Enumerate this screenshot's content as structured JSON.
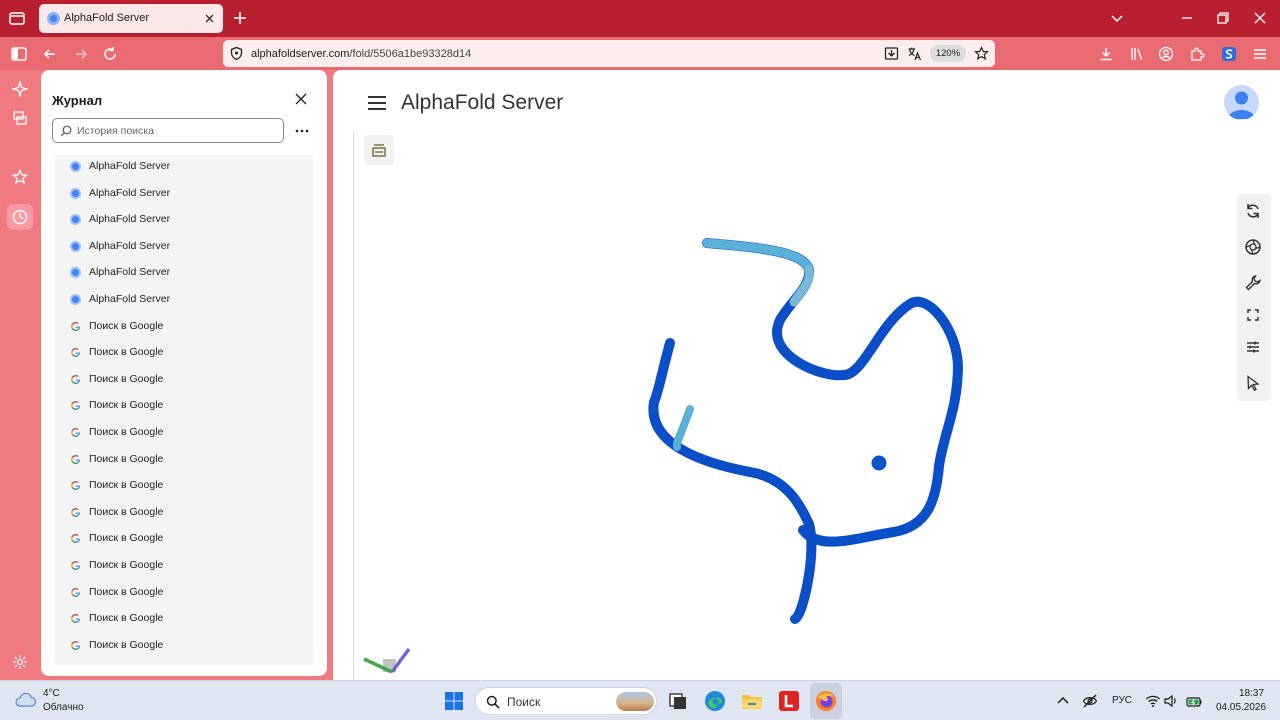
{
  "browser": {
    "tab_title": "AlphaFold Server",
    "url_host": "alphafoldserver.com",
    "url_path": "/fold/5506a1be93328d14",
    "zoom": "120%"
  },
  "sidebar": {
    "title": "Журнал",
    "search_placeholder": "История поиска",
    "items": [
      {
        "label": "AlphaFold Server",
        "icon": "alphafold-icon"
      },
      {
        "label": "AlphaFold Server",
        "icon": "alphafold-icon"
      },
      {
        "label": "AlphaFold Server",
        "icon": "alphafold-icon"
      },
      {
        "label": "AlphaFold Server",
        "icon": "alphafold-icon"
      },
      {
        "label": "AlphaFold Server",
        "icon": "alphafold-icon"
      },
      {
        "label": "AlphaFold Server",
        "icon": "alphafold-icon"
      },
      {
        "label": "Поиск в Google",
        "icon": "google-icon"
      },
      {
        "label": "Поиск в Google",
        "icon": "google-icon"
      },
      {
        "label": "Поиск в Google",
        "icon": "google-icon"
      },
      {
        "label": "Поиск в Google",
        "icon": "google-icon"
      },
      {
        "label": "Поиск в Google",
        "icon": "google-icon"
      },
      {
        "label": "Поиск в Google",
        "icon": "google-icon"
      },
      {
        "label": "Поиск в Google",
        "icon": "google-icon"
      },
      {
        "label": "Поиск в Google",
        "icon": "google-icon"
      },
      {
        "label": "Поиск в Google",
        "icon": "google-icon"
      },
      {
        "label": "Поиск в Google",
        "icon": "google-icon"
      },
      {
        "label": "Поиск в Google",
        "icon": "google-icon"
      },
      {
        "label": "Поиск в Google",
        "icon": "google-icon"
      },
      {
        "label": "Поиск в Google",
        "icon": "google-icon"
      },
      {
        "label": "Поиск в Google",
        "icon": "google-icon"
      }
    ]
  },
  "app": {
    "title": "AlphaFold Server"
  },
  "structure_colors": {
    "high_confidence": "#0b4fc8",
    "low_confidence": "#5bb0d8",
    "ligand": "#0a56c9"
  },
  "taskbar": {
    "weather_temp": "4°C",
    "weather_desc": "Облачно",
    "search_placeholder": "Поиск",
    "lang": "РУС",
    "time": "18:37",
    "date": "04.05.2026"
  }
}
